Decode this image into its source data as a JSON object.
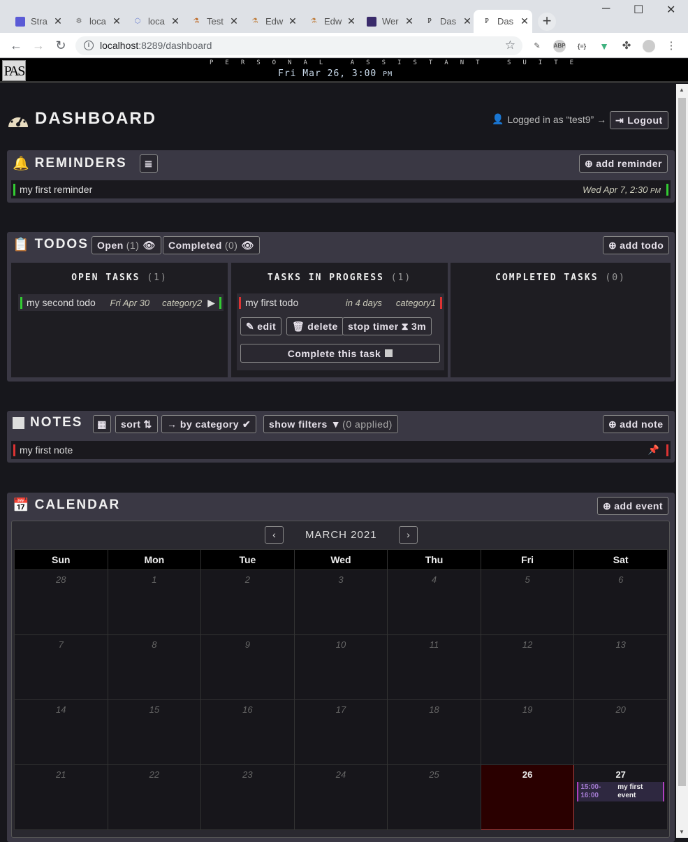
{
  "browser": {
    "tabs": [
      {
        "title": "Stra",
        "icon": "strapi-icon",
        "color": "#5b5bd6"
      },
      {
        "title": "loca",
        "icon": "gear-icon",
        "color": "#888888"
      },
      {
        "title": "loca",
        "icon": "graphql-icon",
        "color": "#6a7fd0"
      },
      {
        "title": "Test",
        "icon": "test-icon",
        "color": "#c07030"
      },
      {
        "title": "Edw",
        "icon": "edw-icon",
        "color": "#c08040"
      },
      {
        "title": "Edw",
        "icon": "edw-icon",
        "color": "#c08040"
      },
      {
        "title": "Wer",
        "icon": "wer-icon",
        "color": "#3a2b6b"
      },
      {
        "title": "Das",
        "icon": "pas-icon",
        "color": "#222222"
      },
      {
        "title": "Das",
        "icon": "pas-icon",
        "color": "#222222"
      }
    ],
    "url_host": "localhost",
    "url_rest": ":8289/dashboard"
  },
  "app": {
    "logo": "PAS",
    "suite": "PERSONAL ASSISTANT SUITE",
    "clock": "Fri Mar 26, 3:00",
    "clock_ampm": "PM"
  },
  "dashboard": {
    "title": "DASHBOARD",
    "login_text": "Logged in as “test9” →",
    "logout": "Logout"
  },
  "reminders": {
    "title": "REMINDERS",
    "add": "add reminder",
    "items": [
      {
        "text": "my first reminder",
        "when": "Wed Apr 7, 2:30",
        "ampm": "PM"
      }
    ]
  },
  "todos": {
    "title": "TODOS",
    "open_label": "Open",
    "open_count": "(1)",
    "completed_label": "Completed",
    "completed_count": "(0)",
    "add": "add todo",
    "columns": [
      {
        "title": "OPEN TASKS",
        "count": "(1)"
      },
      {
        "title": "TASKS IN PROGRESS",
        "count": "(1)"
      },
      {
        "title": "COMPLETED TASKS",
        "count": "(0)"
      }
    ],
    "open_task": {
      "text": "my second todo",
      "due": "Fri Apr 30",
      "category": "category2"
    },
    "progress_task": {
      "text": "my first todo",
      "due": "in 4 days",
      "category": "category1"
    },
    "actions": {
      "edit": "edit",
      "delete": "delete",
      "stop_timer": "stop timer",
      "timer_value": "3m",
      "complete": "Complete this task"
    }
  },
  "notes": {
    "title": "NOTES",
    "sort": "sort",
    "by_category": "→ by category",
    "show_filters": "show filters",
    "applied": "(0 applied)",
    "add": "add note",
    "items": [
      {
        "text": "my first note"
      }
    ]
  },
  "calendar": {
    "title": "CALENDAR",
    "add": "add event",
    "month": "MARCH 2021",
    "weekdays": [
      "Sun",
      "Mon",
      "Tue",
      "Wed",
      "Thu",
      "Fri",
      "Sat"
    ],
    "weeks": [
      [
        "28",
        "1",
        "2",
        "3",
        "4",
        "5",
        "6"
      ],
      [
        "7",
        "8",
        "9",
        "10",
        "11",
        "12",
        "13"
      ],
      [
        "14",
        "15",
        "16",
        "17",
        "18",
        "19",
        "20"
      ],
      [
        "21",
        "22",
        "23",
        "24",
        "25",
        "26",
        "27"
      ]
    ],
    "event": {
      "time": "15:00-16:00",
      "name": "my first event"
    }
  }
}
